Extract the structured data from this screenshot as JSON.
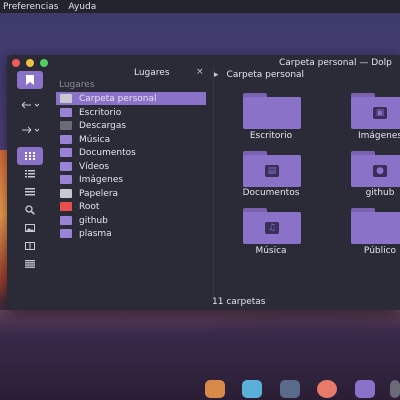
{
  "menubar": {
    "items": [
      "Preferencias",
      "Ayuda"
    ]
  },
  "window": {
    "title": "Carpeta personal — Dolp"
  },
  "places": {
    "title": "Lugares",
    "close": "×",
    "header": "Lugares",
    "items": [
      {
        "label": "Carpeta personal",
        "selected": true
      },
      {
        "label": "Escritorio"
      },
      {
        "label": "Descargas"
      },
      {
        "label": "Música"
      },
      {
        "label": "Documentos"
      },
      {
        "label": "Vídeos"
      },
      {
        "label": "Imágenes"
      },
      {
        "label": "Papelera"
      },
      {
        "label": "Root"
      },
      {
        "label": "github"
      },
      {
        "label": "plasma"
      }
    ]
  },
  "breadcrumb": {
    "arrow": "▸",
    "label": "Carpeta personal"
  },
  "folders": [
    {
      "label": "Escritorio",
      "icon": "none"
    },
    {
      "label": "Imágenes",
      "icon": "image-icon"
    },
    {
      "label": "Documentos",
      "icon": "document-icon"
    },
    {
      "label": "github",
      "icon": "github-icon"
    },
    {
      "label": "Música",
      "icon": "music-icon"
    },
    {
      "label": "Público",
      "icon": "none"
    }
  ],
  "status": "11 carpetas",
  "colors": {
    "accent": "#8a72c8",
    "window_bg": "#2b2b38",
    "folder": "#8a72c8"
  }
}
